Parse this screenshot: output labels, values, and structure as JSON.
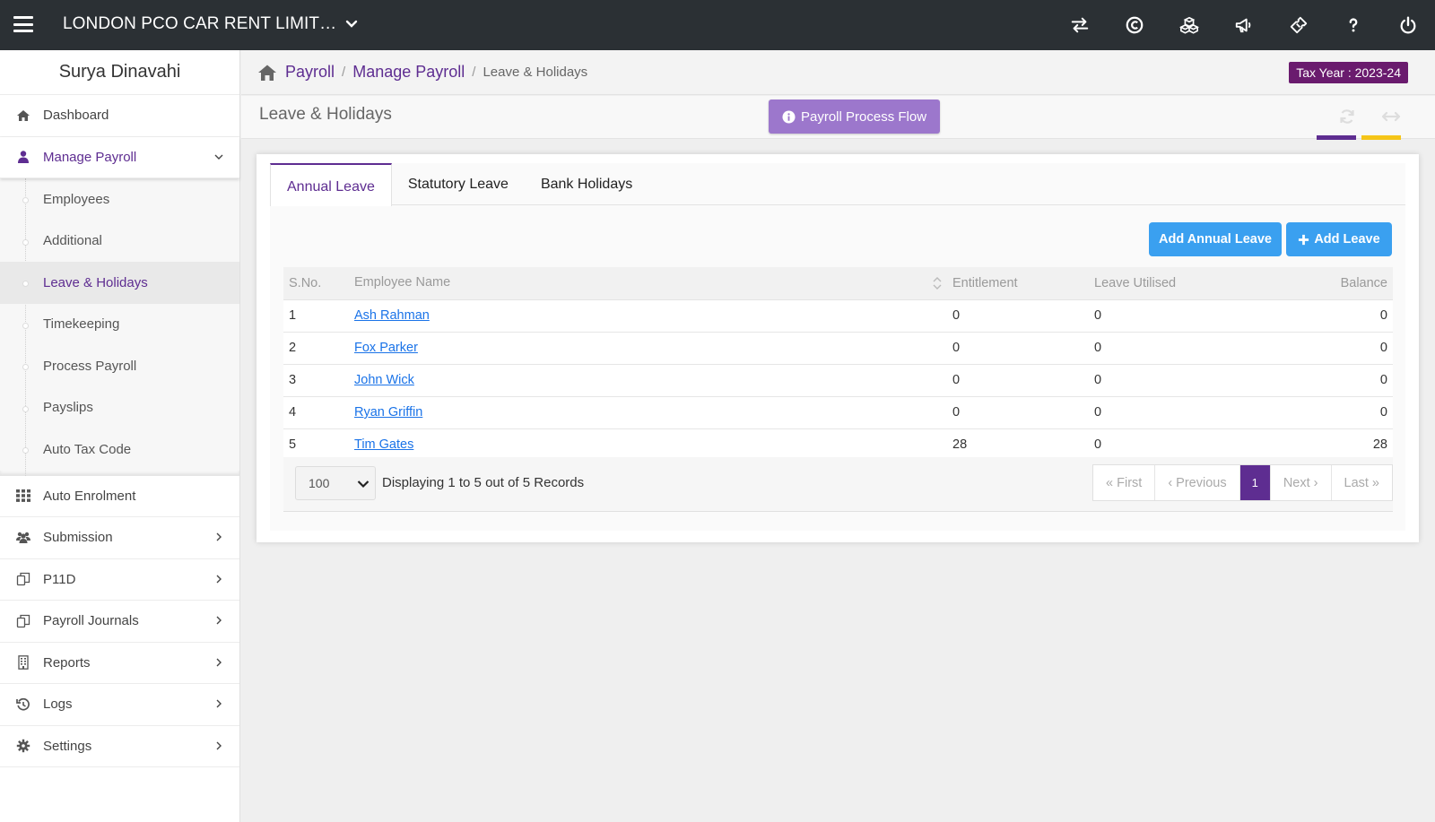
{
  "topbar": {
    "company": "LONDON PCO CAR RENT LIMIT…",
    "icons": [
      "transfer-icon",
      "currency-icon",
      "cubes-icon",
      "megaphone-icon",
      "ticket-icon",
      "help-icon",
      "power-icon"
    ]
  },
  "sidebar": {
    "user_name": "Surya Dinavahi",
    "dashboard": "Dashboard",
    "manage_payroll": "Manage Payroll",
    "sub_items": [
      "Employees",
      "Additional",
      "Leave & Holidays",
      "Timekeeping",
      "Process Payroll",
      "Payslips",
      "Auto Tax Code"
    ],
    "auto_enrolment": "Auto Enrolment",
    "submission": "Submission",
    "p11d": "P11D",
    "payroll_journals": "Payroll Journals",
    "reports": "Reports",
    "logs": "Logs",
    "settings": "Settings"
  },
  "breadcrumb": {
    "payroll": "Payroll",
    "manage_payroll": "Manage Payroll",
    "current": "Leave & Holidays",
    "sep": "/"
  },
  "tax_year": "Tax Year : 2023-24",
  "page": {
    "title": "Leave & Holidays",
    "process_flow_label": "Payroll Process Flow"
  },
  "tabs": [
    "Annual Leave",
    "Statutory Leave",
    "Bank Holidays"
  ],
  "buttons": {
    "add_annual_leave": "Add Annual Leave",
    "add_leave": "Add Leave"
  },
  "table": {
    "headers": [
      "S.No.",
      "Employee Name",
      "Entitlement",
      "Leave Utilised",
      "Balance"
    ],
    "rows": [
      {
        "sno": "1",
        "name": "Ash Rahman",
        "entitlement": "0",
        "utilised": "0",
        "balance": "0"
      },
      {
        "sno": "2",
        "name": "Fox Parker",
        "entitlement": "0",
        "utilised": "0",
        "balance": "0"
      },
      {
        "sno": "3",
        "name": "John Wick",
        "entitlement": "0",
        "utilised": "0",
        "balance": "0"
      },
      {
        "sno": "4",
        "name": "Ryan Griffin",
        "entitlement": "0",
        "utilised": "0",
        "balance": "0"
      },
      {
        "sno": "5",
        "name": "Tim Gates",
        "entitlement": "28",
        "utilised": "0",
        "balance": "28"
      }
    ]
  },
  "footer": {
    "page_size": "100",
    "display_text": "Displaying 1 to 5 out of 5 Records",
    "first": "« First",
    "previous": "‹ Previous",
    "current_page": "1",
    "next": "Next ›",
    "last": "Last »"
  },
  "colors": {
    "accent": "#5e2d91",
    "topbar": "#2b3034",
    "button_blue": "#3aa0f0",
    "tax_badge": "#6a1b6e",
    "process_button": "#9c77cc"
  }
}
